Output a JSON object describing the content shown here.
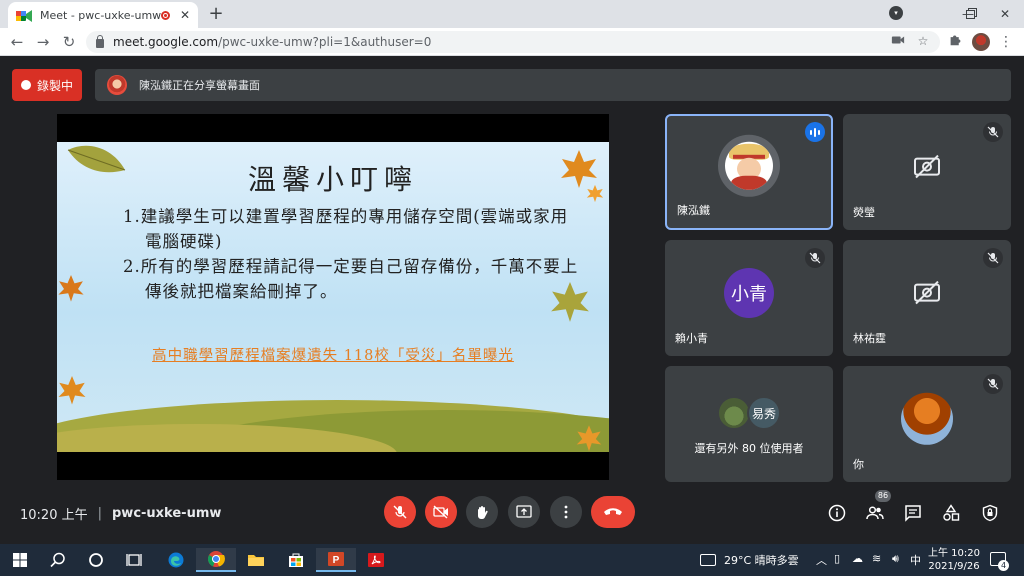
{
  "browser": {
    "tab_title": "Meet - pwc-uxke-umw",
    "tab_close": "✕",
    "new_tab": "+",
    "url_host": "meet.google.com",
    "url_path": "/pwc-uxke-umw?pli=1&authuser=0"
  },
  "meet": {
    "recording_label": "錄製中",
    "share_banner": "陳泓鐵正在分享螢幕畫面",
    "slide": {
      "title": "溫馨小叮嚀",
      "items": [
        "1.建議學生可以建置學習歷程的專用儲存空間(雲端或家用電腦硬碟)",
        "2.所有的學習歷程請記得一定要自己留存備份，千萬不要上傳後就把檔案給刪掉了。"
      ],
      "link": "高中職學習歷程檔案爆遺失 118校「受災」名單曝光"
    },
    "participants": [
      {
        "name": "陳泓鐵",
        "speaking": true
      },
      {
        "name": "熒瑩",
        "muted": true,
        "camera_off": true
      },
      {
        "name": "賴小青",
        "initials": "小青",
        "muted": true
      },
      {
        "name": "林祐霆",
        "muted": true,
        "camera_off": true
      },
      {
        "others_label": "還有另外 80 位使用者",
        "second_initial": "易秀"
      },
      {
        "name": "你",
        "muted": true
      }
    ],
    "time": "10:20 上午",
    "separator": "|",
    "meeting_code": "pwc-uxke-umw",
    "people_count": "86",
    "accent_red": "#ea4335",
    "accent_blue": "#8ab4f8"
  },
  "taskbar": {
    "weather": "29°C 晴時多雲",
    "ime": "中",
    "clock_time": "上午 10:20",
    "clock_date": "2021/9/26",
    "notifications": "4"
  }
}
